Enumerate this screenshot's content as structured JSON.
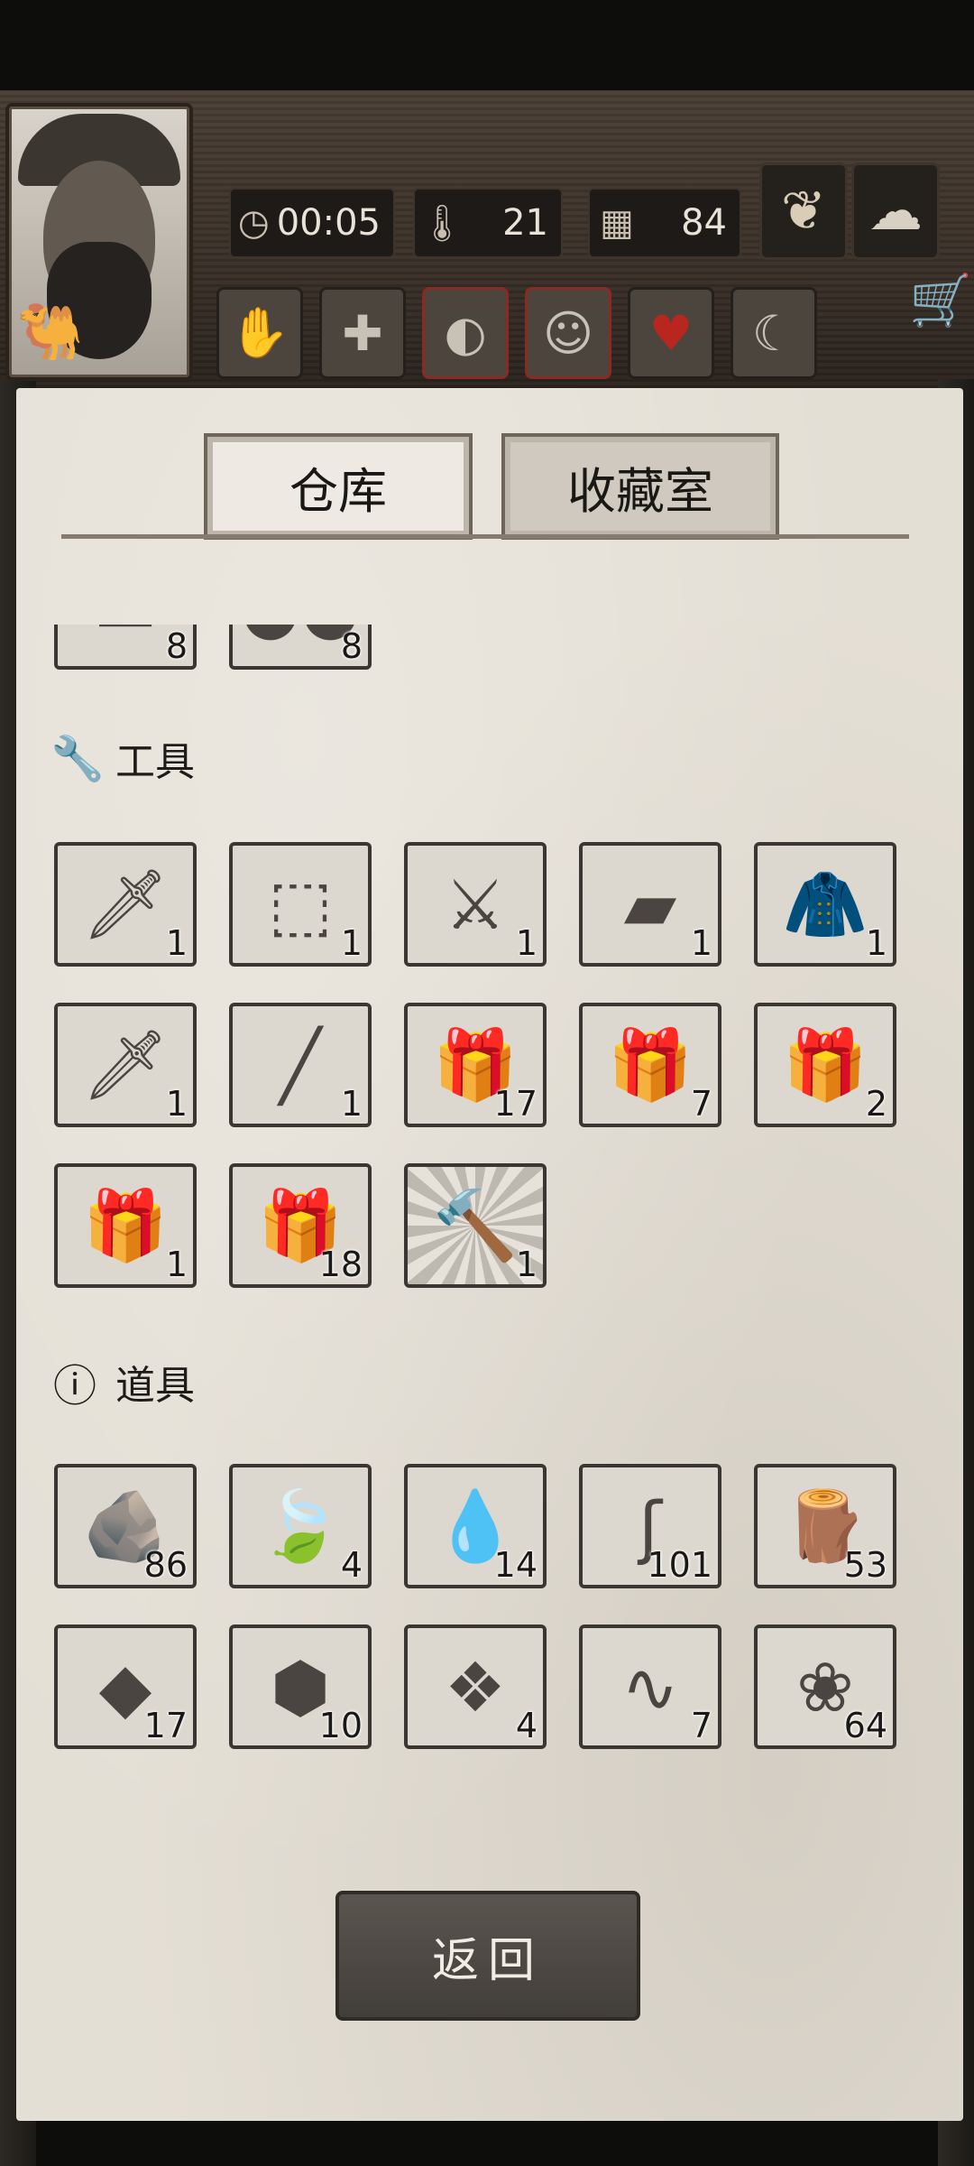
{
  "hud": {
    "time": "00:05",
    "temperature": "21",
    "days": "84",
    "icons": {
      "time": "clock-icon",
      "temp": "thermometer-icon",
      "days": "calendar-icon",
      "sprout": "sprout-icon",
      "weather": "cloud-icon",
      "cart": "shopping-cart-icon"
    },
    "status": [
      "hand-icon",
      "medical-cross-icon",
      "stomach-icon",
      "head-icon",
      "heart-icon",
      "moon-icon"
    ]
  },
  "tabs": [
    {
      "label": "仓库",
      "active": true
    },
    {
      "label": "收藏室",
      "active": false
    }
  ],
  "top_partial": [
    {
      "qty": "8",
      "icon": "item-icon"
    },
    {
      "qty": "8",
      "icon": "berries-icon"
    }
  ],
  "tools": {
    "title": "工具",
    "icon": "wrench-icon",
    "items": [
      {
        "qty": "1",
        "icon": "knife-icon"
      },
      {
        "qty": "1",
        "icon": "empty-clothing-slot-icon"
      },
      {
        "qty": "1",
        "icon": "saber-icon"
      },
      {
        "qty": "1",
        "icon": "torch-icon"
      },
      {
        "qty": "1",
        "icon": "fur-coat-icon"
      },
      {
        "qty": "1",
        "icon": "serrated-sword-icon"
      },
      {
        "qty": "1",
        "icon": "spear-icon"
      },
      {
        "qty": "17",
        "icon": "gift-box-food-icon"
      },
      {
        "qty": "7",
        "icon": "gift-box-medical-icon"
      },
      {
        "qty": "2",
        "icon": "gift-box-weapon-icon"
      },
      {
        "qty": "1",
        "icon": "gift-box-tools-icon"
      },
      {
        "qty": "18",
        "icon": "gift-box-materials-icon"
      },
      {
        "qty": "1",
        "icon": "hammer-icon"
      }
    ]
  },
  "props": {
    "title": "道具",
    "icon": "question-icon",
    "items": [
      {
        "qty": "86",
        "icon": "stone-icon"
      },
      {
        "qty": "4",
        "icon": "leaf-icon"
      },
      {
        "qty": "14",
        "icon": "water-puddle-icon"
      },
      {
        "qty": "101",
        "icon": "vine-icon"
      },
      {
        "qty": "53",
        "icon": "wood-planks-icon"
      },
      {
        "qty": "17",
        "icon": "flint-icon"
      },
      {
        "qty": "10",
        "icon": "ore-icon"
      },
      {
        "qty": "4",
        "icon": "animal-hide-icon"
      },
      {
        "qty": "7",
        "icon": "rope-icon"
      },
      {
        "qty": "64",
        "icon": "herb-icon"
      }
    ]
  },
  "return_label": "返回"
}
